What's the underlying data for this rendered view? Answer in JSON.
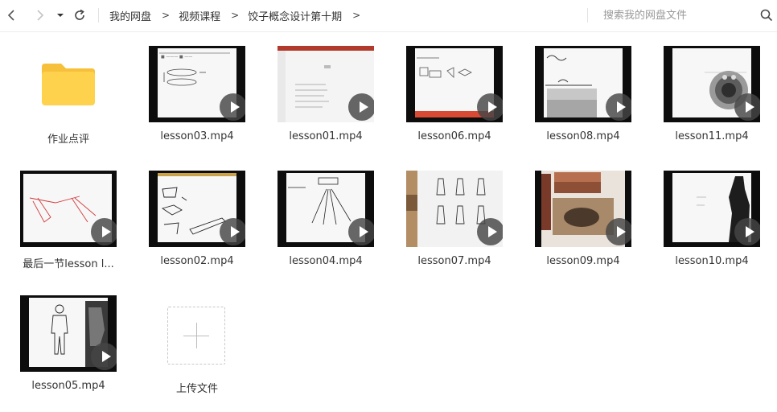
{
  "toolbar": {
    "back_icon": "chevron-left-icon",
    "forward_icon": "chevron-right-icon",
    "dropdown_icon": "caret-down-icon",
    "refresh_icon": "refresh-icon"
  },
  "breadcrumb": {
    "items": [
      "我的网盘",
      "视频课程",
      "饺子概念设计第十期"
    ],
    "separator": ">"
  },
  "search": {
    "placeholder": "搜索我的网盘文件",
    "value": "",
    "icon": "search-icon"
  },
  "files": [
    {
      "name": "作业点评",
      "type": "folder"
    },
    {
      "name": "lesson03.mp4",
      "type": "video"
    },
    {
      "name": "lesson01.mp4",
      "type": "video"
    },
    {
      "name": "lesson06.mp4",
      "type": "video"
    },
    {
      "name": "lesson08.mp4",
      "type": "video"
    },
    {
      "name": "lesson11.mp4",
      "type": "video"
    },
    {
      "name": "最后一节lesson l...",
      "type": "video"
    },
    {
      "name": "lesson02.mp4",
      "type": "video"
    },
    {
      "name": "lesson04.mp4",
      "type": "video"
    },
    {
      "name": "lesson07.mp4",
      "type": "video"
    },
    {
      "name": "lesson09.mp4",
      "type": "video"
    },
    {
      "name": "lesson10.mp4",
      "type": "video"
    },
    {
      "name": "lesson05.mp4",
      "type": "video"
    },
    {
      "name": "上传文件",
      "type": "upload"
    }
  ],
  "colors": {
    "folder": "#FFD24D",
    "folder_tab": "#F7C03A",
    "thumb_frame": "#0d0d0d",
    "play_overlay": "#464646"
  }
}
